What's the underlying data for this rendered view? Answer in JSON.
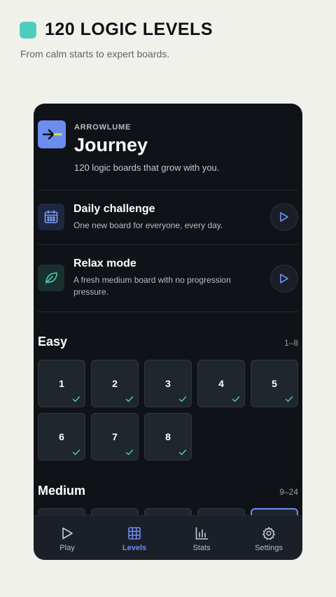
{
  "promo": {
    "title": "120 LOGIC LEVELS",
    "subtitle": "From calm starts to expert boards."
  },
  "header": {
    "brand": "ARROWLUME",
    "title": "Journey",
    "tagline": "120 logic boards that grow with you."
  },
  "cards": {
    "daily": {
      "title": "Daily challenge",
      "desc": "One new board for everyone, every day."
    },
    "relax": {
      "title": "Relax mode",
      "desc": "A fresh medium board with no progression pressure."
    }
  },
  "sections": {
    "easy": {
      "title": "Easy",
      "range": "1–8",
      "levels": [
        {
          "num": "1",
          "done": true
        },
        {
          "num": "2",
          "done": true
        },
        {
          "num": "3",
          "done": true
        },
        {
          "num": "4",
          "done": true
        },
        {
          "num": "5",
          "done": true
        },
        {
          "num": "6",
          "done": true
        },
        {
          "num": "7",
          "done": true
        },
        {
          "num": "8",
          "done": true
        }
      ]
    },
    "medium": {
      "title": "Medium",
      "range": "9–24"
    }
  },
  "nav": {
    "items": [
      {
        "label": "Play",
        "icon": "play-icon"
      },
      {
        "label": "Levels",
        "icon": "grid-icon",
        "active": true
      },
      {
        "label": "Stats",
        "icon": "bar-chart-icon"
      },
      {
        "label": "Settings",
        "icon": "gear-icon"
      }
    ]
  },
  "colors": {
    "accent": "#6d8cf0",
    "teal": "#4ecdbc",
    "background": "#0f1217"
  }
}
